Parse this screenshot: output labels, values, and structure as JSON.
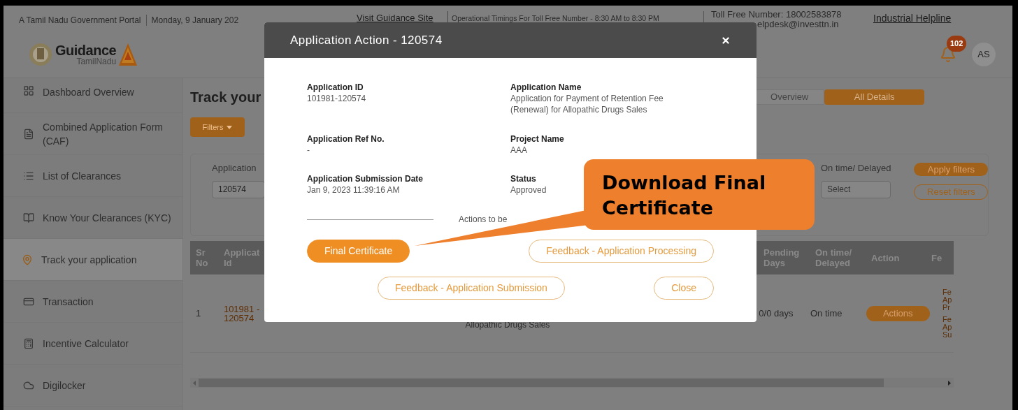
{
  "top_bar": {
    "portal": "A Tamil Nadu Government Portal",
    "date": "Monday, 9 January 202",
    "guidance_link": "Visit Guidance Site",
    "timings": "Operational Timings For Toll Free Number - 8:30 AM to 8:30 PM",
    "toll_free": "Toll Free Number: 18002583878",
    "email": "elpdesk@investtn.in",
    "helpline_link": "Industrial Helpline"
  },
  "header": {
    "logo_title": "Guidance",
    "logo_subtitle": "TamilNadu",
    "notification_count": "102",
    "avatar": "AS"
  },
  "sidebar": {
    "items": [
      {
        "label": "Dashboard Overview",
        "kind": "dashboard",
        "selected": false
      },
      {
        "label": "Combined Application Form (CAF)",
        "kind": "form",
        "selected": false
      },
      {
        "label": "List of Clearances",
        "kind": "list",
        "selected": false
      },
      {
        "label": "Know Your Clearances (KYC)",
        "kind": "book",
        "selected": false
      },
      {
        "label": "Track your application",
        "kind": "track",
        "selected": true
      },
      {
        "label": "Transaction",
        "kind": "transaction",
        "selected": false
      },
      {
        "label": "Incentive Calculator",
        "kind": "calculator",
        "selected": false
      },
      {
        "label": "Digilocker",
        "kind": "cloud",
        "selected": false
      }
    ]
  },
  "main": {
    "title": "Track your",
    "filters_button": "Filters",
    "view_tabs": [
      {
        "label": "Overview",
        "selected": false
      },
      {
        "label": "All Details",
        "selected": true
      }
    ],
    "application_filter": {
      "label": "Application",
      "value": "120574"
    },
    "status_filter": {
      "label": "On time/ Delayed",
      "placeholder": "Select"
    },
    "apply_button": "Apply filters",
    "reset_button": "Reset filters",
    "table": {
      "columns": [
        "Sr No",
        "Applicat Id",
        "Pending Days",
        "On time/ Delayed",
        "Action",
        "Fe"
      ],
      "rows": [
        {
          "sr": "1",
          "application_id": "101981 - 120574",
          "name": "Allopathic Drugs Sales",
          "pending_days": "0/0 days",
          "status": "On time",
          "action_button": "Actions",
          "feedback_links": [
            "Fe Ap Pr",
            "Fe Ap Su"
          ]
        }
      ]
    }
  },
  "modal": {
    "title": "Application Action - 120574",
    "fields": [
      {
        "label": "Application ID",
        "value": "101981-120574"
      },
      {
        "label": "Application Name",
        "value": "Application for Payment of Retention Fee (Renewal) for Allopathic Drugs Sales"
      },
      {
        "label": "Application Ref No.",
        "value": "-"
      },
      {
        "label": "Project Name",
        "value": "AAA"
      },
      {
        "label": "Application Submission Date",
        "value": "Jan 9, 2023 11:39:16 AM"
      },
      {
        "label": "Status",
        "value": "Approved"
      }
    ],
    "actions_label": "Actions to be",
    "buttons": [
      {
        "label": "Final Certificate",
        "kind": "primary"
      },
      {
        "label": "Feedback - Application Processing",
        "kind": "outline"
      },
      {
        "label": "Feedback - Application Submission",
        "kind": "outline"
      },
      {
        "label": "Close",
        "kind": "outline"
      }
    ]
  },
  "callout": {
    "text": "Download Final Certificate"
  }
}
